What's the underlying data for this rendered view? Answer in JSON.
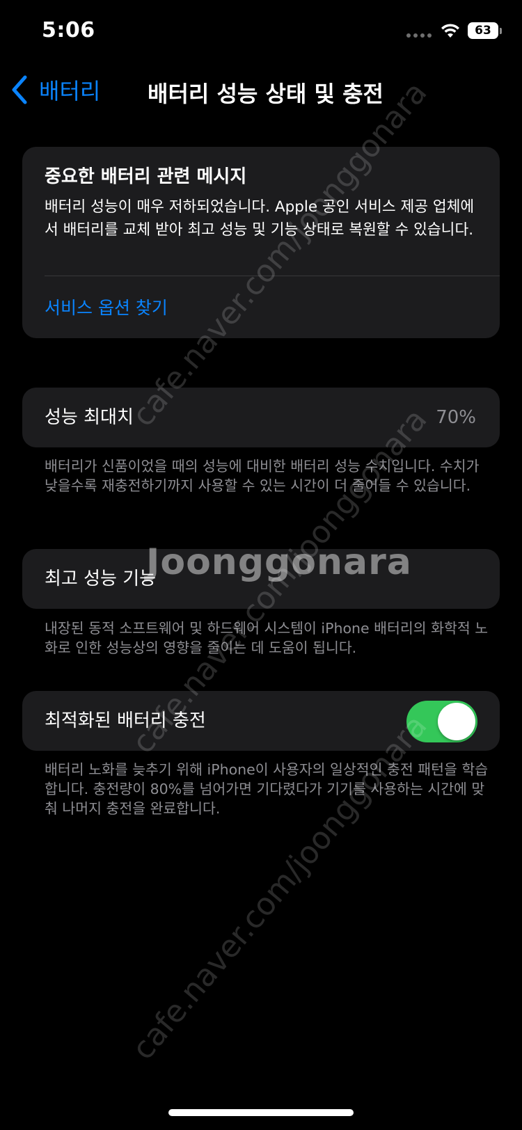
{
  "status_bar": {
    "time": "5:06",
    "battery_level": "63"
  },
  "nav": {
    "back_label": "배터리",
    "title": "배터리 성능 상태 및 충전"
  },
  "battery_message": {
    "title": "중요한 배터리 관련 메시지",
    "body": "배터리 성능이 매우 저하되었습니다. Apple 공인 서비스 제공 업체에서 배터리를 교체 받아 최고 성능 및 기능 상태로 복원할 수 있습니다.",
    "link": "서비스 옵션 찾기"
  },
  "max_capacity": {
    "label": "성능 최대치",
    "value": "70%",
    "footnote": "배터리가 신품이었을 때의 성능에 대비한 배터리 성능 수치입니다. 수치가 낮을수록 재충전하기까지 사용할 수 있는 시간이 더 줄어들 수 있습니다."
  },
  "peak_performance": {
    "label": "최고 성능 기능",
    "footnote": "내장된 동적 소프트웨어 및 하드웨어 시스템이 iPhone 배터리의 화학적 노화로 인한 성능상의 영향을 줄이는 데 도움이 됩니다."
  },
  "optimized_charging": {
    "label": "최적화된 배터리 충전",
    "enabled": true,
    "footnote": "배터리 노화를 늦추기 위해 iPhone이 사용자의 일상적인 충전 패턴을 학습합니다. 충전량이 80%를 넘어가면 기다렸다가 기기를 사용하는 시간에 맞춰 나머지 충전을 완료합니다."
  },
  "watermark": {
    "text": "cafe.naver.com/joonggonara",
    "logo": "Joonggonara"
  },
  "colors": {
    "accent": "#0a84ff",
    "toggle_on": "#34c759",
    "card": "#1c1c1e",
    "secondary_text": "#8e8e93"
  }
}
